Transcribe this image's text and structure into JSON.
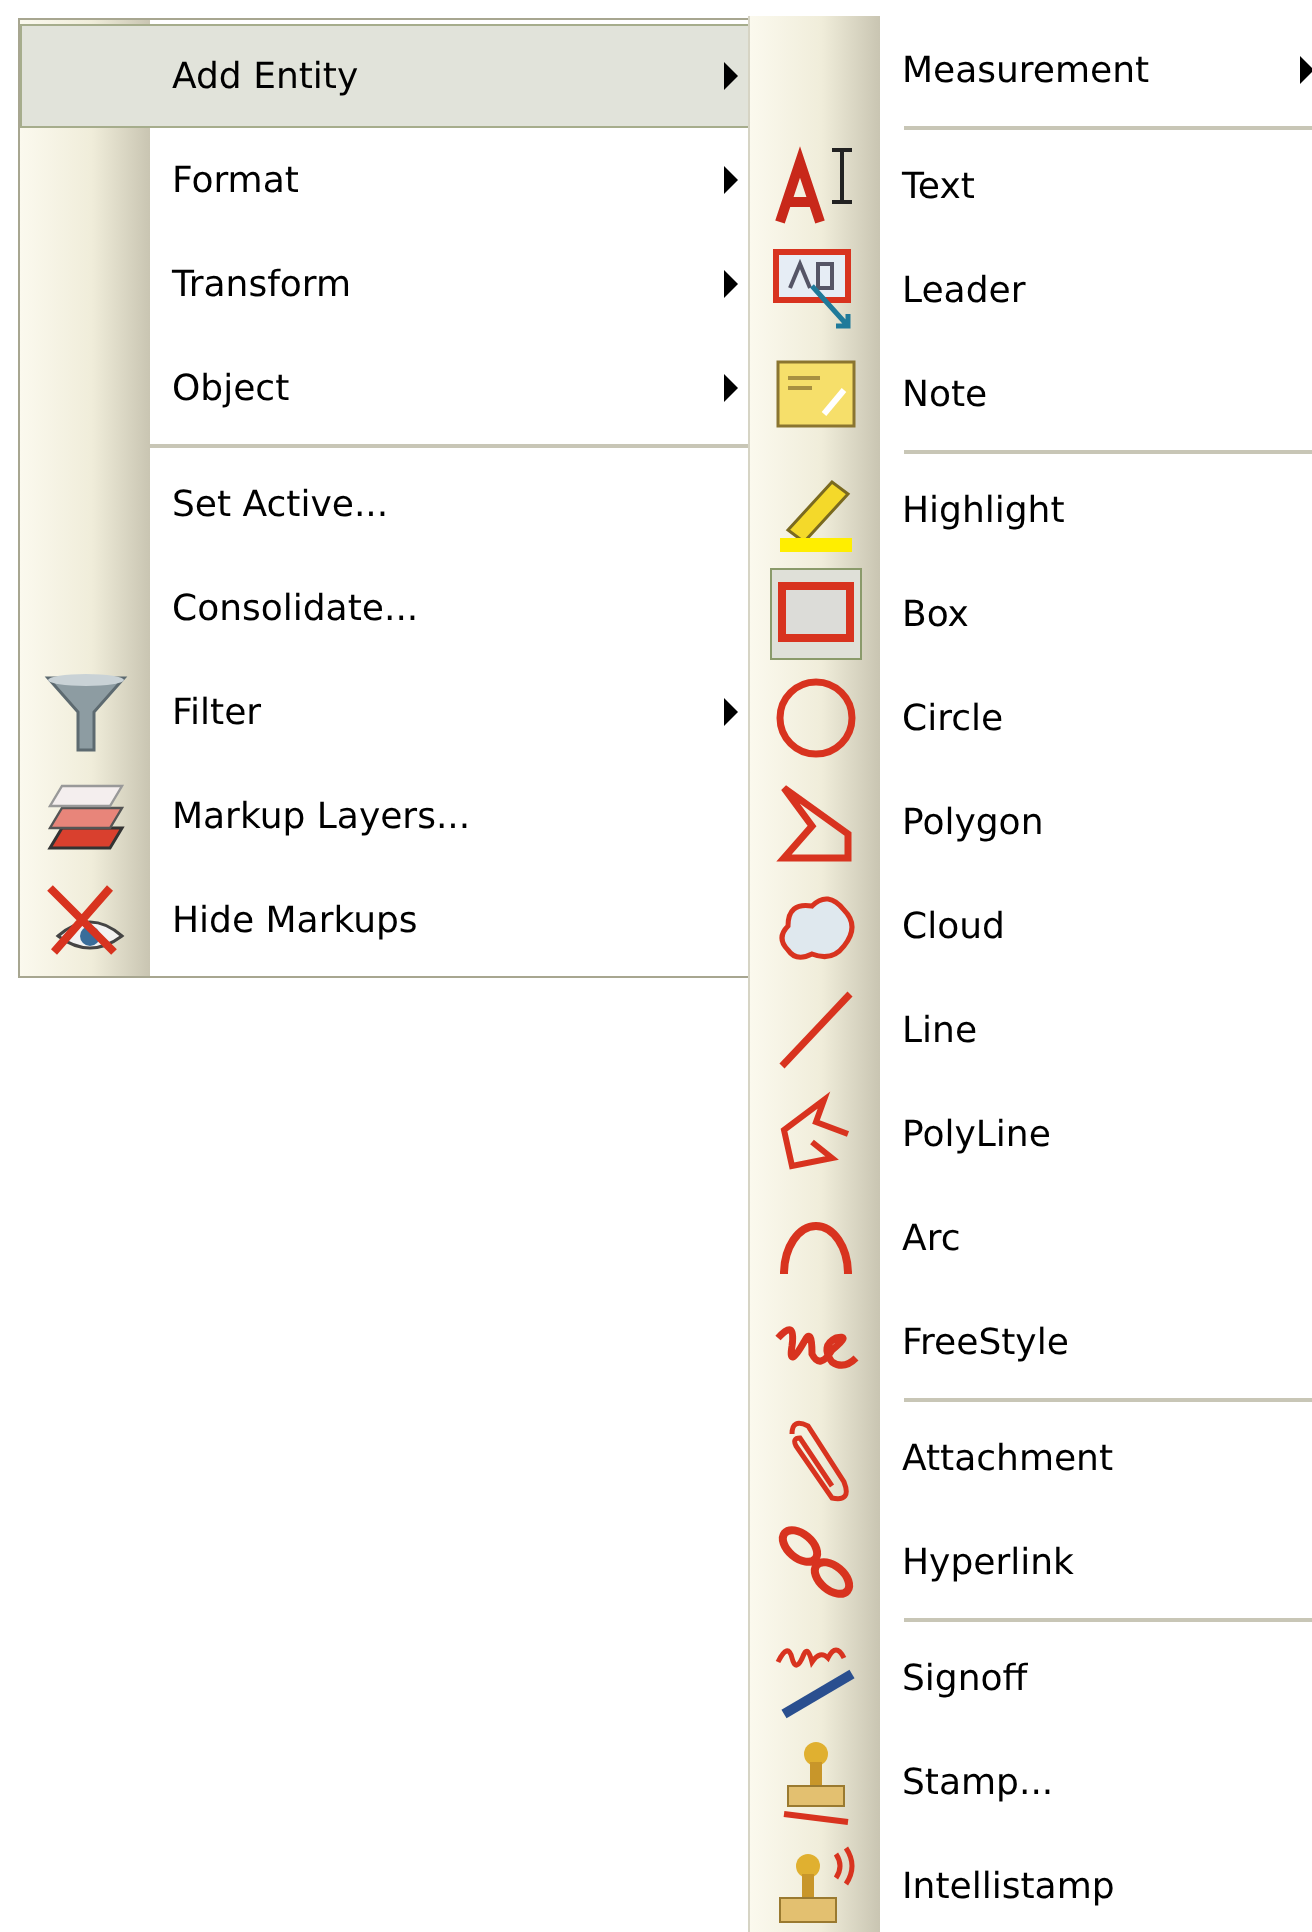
{
  "main_menu": {
    "groups": [
      [
        {
          "label": "Add Entity",
          "submenu": true,
          "selected": true
        },
        {
          "label": "Format",
          "submenu": true,
          "selected": false
        },
        {
          "label": "Transform",
          "submenu": true,
          "selected": false
        },
        {
          "label": "Object",
          "submenu": true,
          "selected": false
        }
      ],
      [
        {
          "label": "Set Active...",
          "submenu": false,
          "selected": false
        },
        {
          "label": "Consolidate...",
          "submenu": false,
          "selected": false
        },
        {
          "label": "Filter",
          "submenu": true,
          "selected": false
        },
        {
          "label": "Markup Layers...",
          "submenu": false,
          "selected": false
        },
        {
          "label": "Hide Markups",
          "submenu": false,
          "selected": false
        }
      ]
    ]
  },
  "submenu": {
    "groups": [
      [
        {
          "label": "Measurement",
          "submenu": true,
          "checked": false
        }
      ],
      [
        {
          "label": "Text",
          "submenu": false,
          "checked": false
        },
        {
          "label": "Leader",
          "submenu": false,
          "checked": false
        },
        {
          "label": "Note",
          "submenu": false,
          "checked": false
        }
      ],
      [
        {
          "label": "Highlight",
          "submenu": false,
          "checked": false
        },
        {
          "label": "Box",
          "submenu": false,
          "checked": true
        },
        {
          "label": "Circle",
          "submenu": false,
          "checked": false
        },
        {
          "label": "Polygon",
          "submenu": false,
          "checked": false
        },
        {
          "label": "Cloud",
          "submenu": false,
          "checked": false
        },
        {
          "label": "Line",
          "submenu": false,
          "checked": false
        },
        {
          "label": "PolyLine",
          "submenu": false,
          "checked": false
        },
        {
          "label": "Arc",
          "submenu": false,
          "checked": false
        },
        {
          "label": "FreeStyle",
          "submenu": false,
          "checked": false
        }
      ],
      [
        {
          "label": "Attachment",
          "submenu": false,
          "checked": false
        },
        {
          "label": "Hyperlink",
          "submenu": false,
          "checked": false
        }
      ],
      [
        {
          "label": "Signoff",
          "submenu": false,
          "checked": false
        },
        {
          "label": "Stamp...",
          "submenu": false,
          "checked": false
        },
        {
          "label": "Intellistamp",
          "submenu": false,
          "checked": false
        }
      ]
    ]
  }
}
